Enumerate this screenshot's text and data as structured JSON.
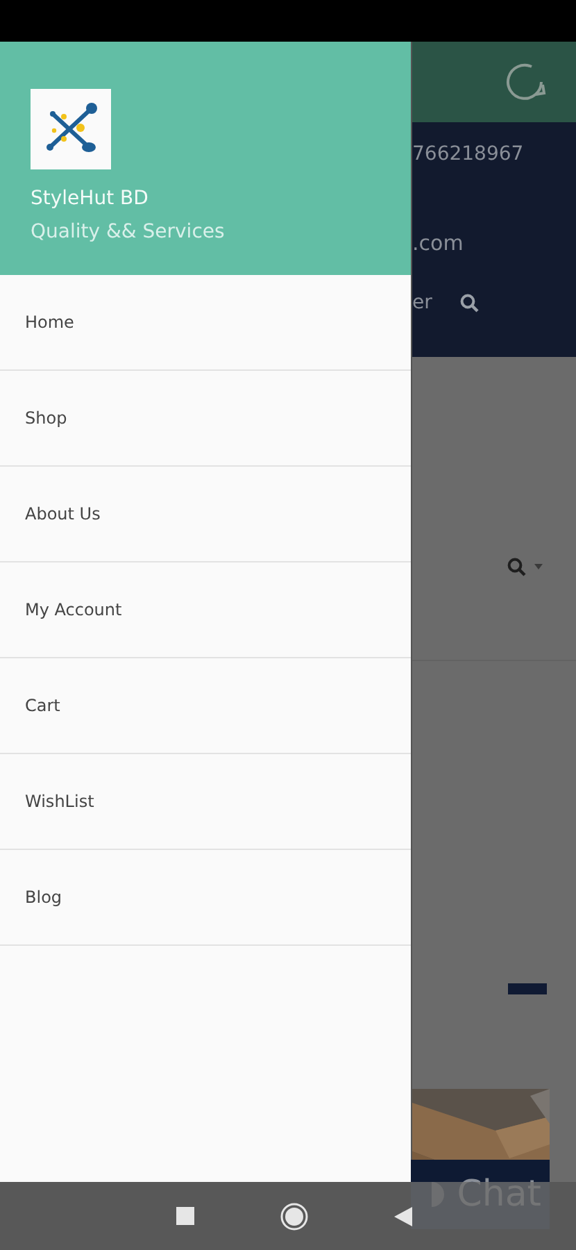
{
  "drawer": {
    "brand": "StyleHut BD",
    "tagline": "Quality && Services",
    "menu": [
      {
        "label": "Home"
      },
      {
        "label": "Shop"
      },
      {
        "label": "About Us"
      },
      {
        "label": "My Account"
      },
      {
        "label": "Cart"
      },
      {
        "label": "WishList"
      },
      {
        "label": "Blog"
      }
    ]
  },
  "background_page": {
    "phone": "766218967",
    "email": ".com",
    "nav_link": "er",
    "chat_button": "Chat"
  }
}
